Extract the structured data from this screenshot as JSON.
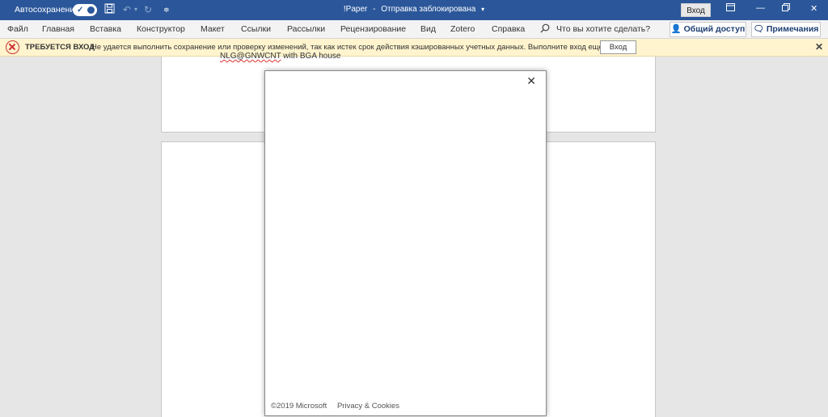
{
  "titlebar": {
    "autosave_label": "Автосохранение",
    "autosave_state": "on",
    "doc_name": "!Paper",
    "separator": "-",
    "doc_status": "Отправка заблокирована",
    "signin_label": "Вход",
    "icons": [
      "save-icon",
      "undo-icon",
      "redo-icon",
      "customize-icon"
    ]
  },
  "ribbon": {
    "tabs": [
      "Файл",
      "Главная",
      "Вставка",
      "Конструктор",
      "Макет",
      "Ссылки",
      "Рассылки",
      "Рецензирование",
      "Вид",
      "Zotero",
      "Справка"
    ],
    "search_placeholder": "Что вы хотите сделать?",
    "share_label": "Общий доступ",
    "comments_label": "Примечания"
  },
  "message_bar": {
    "title": "ТРЕБУЕТСЯ ВХОД",
    "text": "Не удается выполнить сохранение или проверку изменений, так как истек срок действия кэшированных учетных данных. Выполните вход еще раз.",
    "button_label": "Вход"
  },
  "document": {
    "line_misspelled": "NLG@GNWCNT",
    "line_rest": " with BGA house"
  },
  "dialog": {
    "copyright": "©2019 Microsoft",
    "privacy_link": "Privacy & Cookies"
  }
}
